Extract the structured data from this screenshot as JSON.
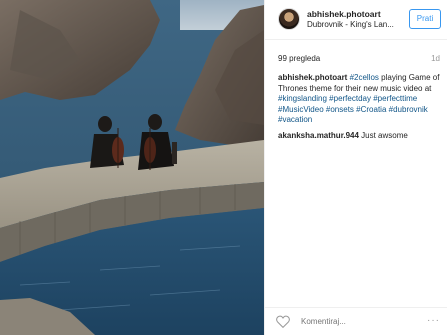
{
  "post": {
    "username": "abhishek.photoart",
    "location": "Dubrovnik - King's Lan...",
    "follow_label": "Prati",
    "views": "99 pregleda",
    "time": "1d",
    "caption_user": "abhishek.photoart",
    "caption_segments": [
      {
        "text": " ",
        "tag": false
      },
      {
        "text": "#2cellos",
        "tag": true
      },
      {
        "text": " playing Game of Thrones theme for their new music video at ",
        "tag": false
      },
      {
        "text": "#kingslanding",
        "tag": true
      },
      {
        "text": " ",
        "tag": false
      },
      {
        "text": "#perfectday",
        "tag": true
      },
      {
        "text": " ",
        "tag": false
      },
      {
        "text": "#perfecttime",
        "tag": true
      },
      {
        "text": " ",
        "tag": false
      },
      {
        "text": "#MusicVideo",
        "tag": true
      },
      {
        "text": " ",
        "tag": false
      },
      {
        "text": "#onsets",
        "tag": true
      },
      {
        "text": " ",
        "tag": false
      },
      {
        "text": "#Croatia",
        "tag": true
      },
      {
        "text": " ",
        "tag": false
      },
      {
        "text": "#dubrovnik",
        "tag": true
      },
      {
        "text": " ",
        "tag": false
      },
      {
        "text": "#vacation",
        "tag": true
      }
    ],
    "comments": [
      {
        "user": "akanksha.mathur.944",
        "text": "Just awsome"
      }
    ],
    "comment_placeholder": "Komentiraj...",
    "more_label": "···"
  },
  "colors": {
    "link": "#125688",
    "button": "#3897f0"
  },
  "icons": {
    "like": "heart-icon",
    "more": "more-options-icon"
  }
}
